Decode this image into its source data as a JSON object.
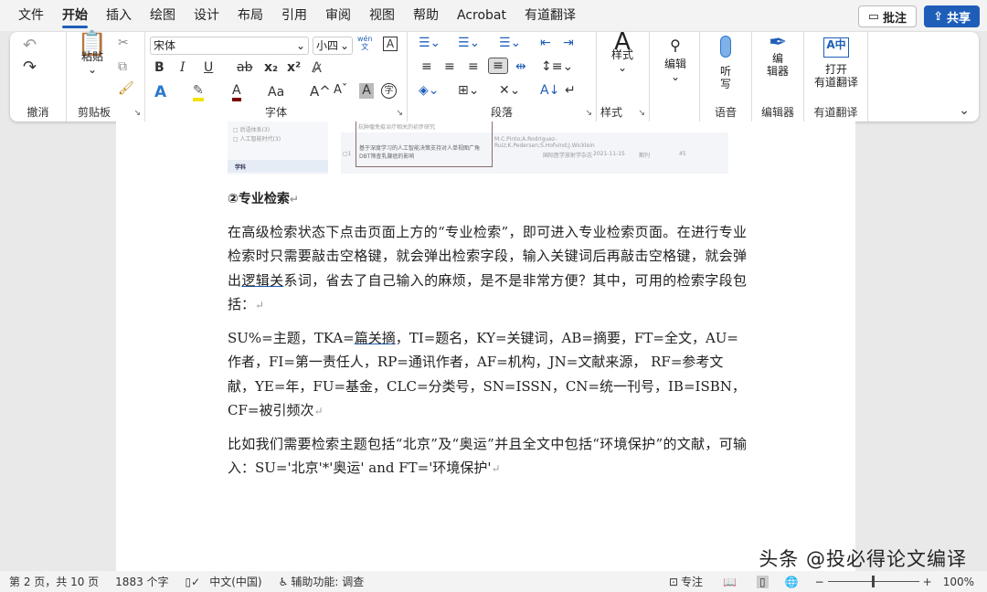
{
  "menu": [
    "文件",
    "开始",
    "插入",
    "绘图",
    "设计",
    "布局",
    "引用",
    "审阅",
    "视图",
    "帮助",
    "Acrobat",
    "有道翻译"
  ],
  "comment_label": "批注",
  "share_label": "共享",
  "ribbon": {
    "undo_group": "撤消",
    "clipboard": {
      "paste": "粘贴",
      "label": "剪贴板"
    },
    "font": {
      "name": "宋体",
      "size": "小四",
      "phonetic": "wén\n文",
      "label": "字体",
      "bold": "B",
      "italic": "I",
      "underline": "U",
      "strike": "ab",
      "sub": "x₂",
      "sup": "x²",
      "case": "Aa",
      "grow": "A^",
      "shrink": "Aˇ",
      "shade": "A",
      "enclose": "字"
    },
    "paragraph": {
      "label": "段落"
    },
    "styles": {
      "button": "样式",
      "label": "样式"
    },
    "editing": {
      "button": "编辑"
    },
    "voice": {
      "button": "听\n写",
      "label": "语音"
    },
    "editor": {
      "button": "编\n辑器",
      "label": "编辑器"
    },
    "youdao": {
      "button": "打开\n有道翻译",
      "label": "有道翻译"
    }
  },
  "doc_image": {
    "filters": [
      "□ 后语体系(3)",
      "□ 人工智能时代(3)"
    ],
    "section": "学科",
    "row_title_prev": "抗肿瘤免疫治疗相关的初步研究",
    "row_title": "基于深度学习的人工智能决策支持对人单视图广角DBT筛查乳腺癌的影响",
    "authors": "M.C.Pinto;A.Rodriguez-Ruiz;K.Pedersen;S.Hofvind;J.Wicklein",
    "journal": "国际医学放射学杂志",
    "date": "2021-11-15",
    "type": "期刊",
    "count": "45",
    "row_num": "□1"
  },
  "document": {
    "heading": "②专业检索",
    "p1": [
      "在高级检索状态下点击页面上方的“专业检索”，即可进入专业检索页面。在进行专业检索时只需要敲击空格键，就会弹出检索字段，输入关键词后再敲击空格键，就会弹出",
      "逻辑关",
      "系词，省去了自己输入的麻烦，是不是非常方便？其中，可用的检索字段包括："
    ],
    "p2": [
      "SU%=主题，TKA=",
      "篇关摘",
      "，TI=题名，KY=关键词，AB=摘要，FT=全文，AU=作者，FI=第一责任人，RP=通讯作者，AF=机构，JN=文献来源， RF=参考文献，YE=年，FU=基金，CLC=分类号，SN=ISSN，CN=统一刊号，IB=ISBN，CF=被引频次"
    ],
    "p3": "比如我们需要检索主题包括“北京”及“奥运”并且全文中包括“环境保护”的文献，可输入：SU='北京'*'奥运' and FT='环境保护'",
    "pilcrow": "↵"
  },
  "watermark": "头条 @投必得论文编译",
  "status": {
    "page": "第 2 页，共 10 页",
    "words": "1883 个字",
    "lang": "中文(中国)",
    "access": "辅助功能: 调查",
    "focus": "专注",
    "zoom": "100%"
  }
}
